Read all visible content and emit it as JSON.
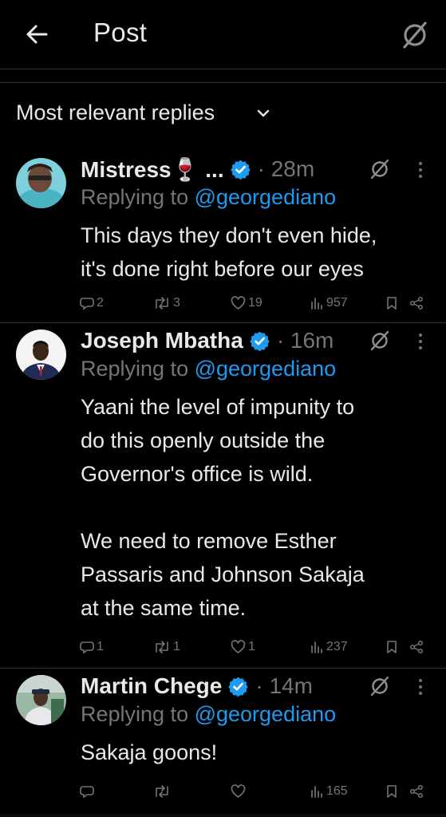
{
  "header": {
    "title": "Post",
    "back_icon": "arrow-left-icon",
    "grok_icon": "grok-icon"
  },
  "sort": {
    "label": "Most relevant replies",
    "icon": "chevron-down-icon"
  },
  "colors": {
    "background": "#000000",
    "text": "#e7e9ea",
    "muted": "#71767b",
    "accent": "#1d9bf0",
    "divider": "#2f3336"
  },
  "replies": [
    {
      "name": "Mistress🍷 ...",
      "verified": true,
      "time": "· 28m",
      "replying_prefix": "Replying to ",
      "replying_handle": "@georgediano",
      "text": "This days they don't even hide,\nit's done right before our eyes",
      "stats": {
        "replies": "2",
        "reposts": "3",
        "likes": "19",
        "views": "957"
      }
    },
    {
      "name": "Joseph Mbatha",
      "verified": true,
      "time": "· 16m",
      "replying_prefix": "Replying to ",
      "replying_handle": "@georgediano",
      "text": "Yaani the level of impunity to\ndo this openly outside the\nGovernor's office is wild.\n\nWe need to remove Esther\nPassaris and Johnson Sakaja\nat the same time.",
      "stats": {
        "replies": "1",
        "reposts": "1",
        "likes": "1",
        "views": "237"
      }
    },
    {
      "name": "Martin Chege",
      "verified": true,
      "time": "· 14m",
      "replying_prefix": "Replying to ",
      "replying_handle": "@georgediano",
      "text": "Sakaja goons!",
      "stats": {
        "replies": "",
        "reposts": "",
        "likes": "",
        "views": "165"
      }
    }
  ]
}
